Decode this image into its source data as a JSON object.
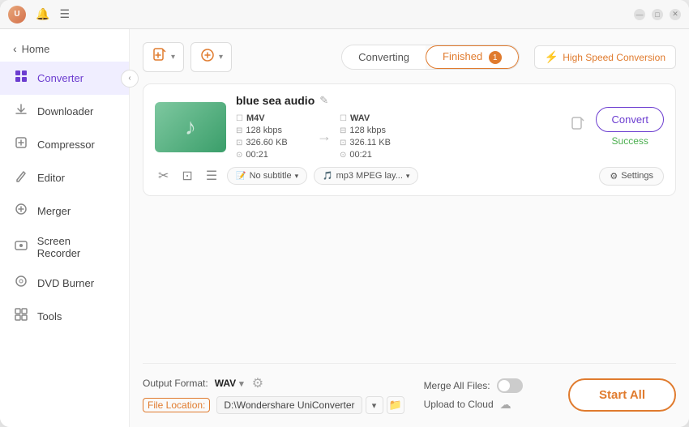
{
  "titleBar": {
    "avatar": "U",
    "bell": "🔔",
    "menu": "☰",
    "minimize": "—",
    "maximize": "□",
    "close": "✕"
  },
  "sidebar": {
    "back": "Home",
    "items": [
      {
        "id": "converter",
        "label": "Converter",
        "icon": "⊡",
        "active": true
      },
      {
        "id": "downloader",
        "label": "Downloader",
        "icon": "⬇"
      },
      {
        "id": "compressor",
        "label": "Compressor",
        "icon": "⊞"
      },
      {
        "id": "editor",
        "label": "Editor",
        "icon": "✏"
      },
      {
        "id": "merger",
        "label": "Merger",
        "icon": "⊕"
      },
      {
        "id": "screenrecorder",
        "label": "Screen Recorder",
        "icon": "⊙"
      },
      {
        "id": "dvdburner",
        "label": "DVD Burner",
        "icon": "◎"
      },
      {
        "id": "tools",
        "label": "Tools",
        "icon": "⚙"
      }
    ]
  },
  "toolbar": {
    "addFileBtn": "📄",
    "addFileLabel": "",
    "addUrlBtn": "🔗",
    "addUrlLabel": "",
    "convertingTab": "Converting",
    "finishedTab": "Finished",
    "finishedBadge": "1",
    "highSpeedLabel": "High Speed Conversion"
  },
  "fileCard": {
    "thumbnail": "♪",
    "fileName": "blue sea audio",
    "source": {
      "format": "M4V",
      "size": "326.60 KB",
      "bitrate": "128 kbps",
      "duration": "00:21"
    },
    "target": {
      "format": "WAV",
      "size": "326.11 KB",
      "bitrate": "128 kbps",
      "duration": "00:21"
    },
    "convertBtn": "Convert",
    "successLabel": "Success",
    "subtitleLabel": "No subtitle",
    "audioLabel": "mp3 MPEG lay...",
    "settingsLabel": "Settings"
  },
  "bottomBar": {
    "outputFormatLabel": "Output Format:",
    "outputFormatValue": "WAV",
    "fileLocationLabel": "File Location:",
    "fileLocationPath": "D:\\Wondershare UniConverter",
    "mergeAllLabel": "Merge All Files:",
    "uploadToCloudLabel": "Upload to Cloud",
    "startAllBtn": "Start All"
  }
}
